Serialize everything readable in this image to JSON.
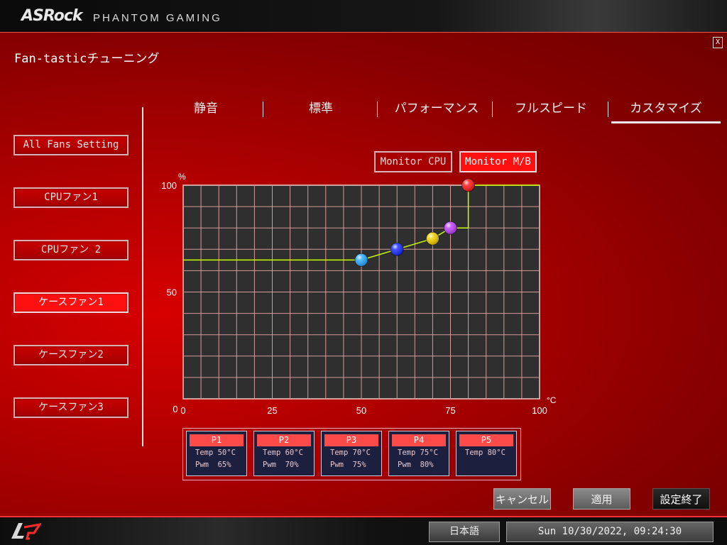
{
  "header": {
    "brand": "ASRock",
    "subtitle": "PHANTOM GAMING"
  },
  "window": {
    "title": "Fan-tasticチューニング",
    "close_label": "X"
  },
  "tabs": [
    {
      "label": "静音",
      "active": false
    },
    {
      "label": "標準",
      "active": false
    },
    {
      "label": "パフォーマンス",
      "active": false
    },
    {
      "label": "フルスピード",
      "active": false
    },
    {
      "label": "カスタマイズ",
      "active": true
    }
  ],
  "sidebar": {
    "items": [
      {
        "label": "All Fans Setting",
        "active": false
      },
      {
        "label": "CPUファン1",
        "active": false
      },
      {
        "label": "CPUファン 2",
        "active": false
      },
      {
        "label": "ケースファン1",
        "active": true
      },
      {
        "label": "ケースファン2",
        "active": false
      },
      {
        "label": "ケースファン3",
        "active": false
      }
    ]
  },
  "monitor": {
    "cpu_label": "Monitor CPU",
    "mb_label": "Monitor M/B",
    "selected": "Monitor M/B"
  },
  "chart_data": {
    "type": "line",
    "y_unit": "%",
    "x_unit": "°C",
    "xlim": [
      0,
      100
    ],
    "ylim": [
      0,
      100
    ],
    "x_ticks": [
      "0",
      "25",
      "50",
      "75",
      "100"
    ],
    "y_ticks": [
      "0",
      "50",
      "100"
    ],
    "grid": true,
    "curve": [
      [
        0,
        65
      ],
      [
        50,
        65
      ],
      [
        60,
        70
      ],
      [
        70,
        75
      ],
      [
        75,
        80
      ],
      [
        80,
        80
      ],
      [
        80,
        100
      ],
      [
        100,
        100
      ]
    ],
    "points": [
      {
        "name": "P1",
        "x": 50,
        "y": 65,
        "color": "#29a9ff"
      },
      {
        "name": "P2",
        "x": 60,
        "y": 70,
        "color": "#1a2bff"
      },
      {
        "name": "P3",
        "x": 70,
        "y": 75,
        "color": "#f0d000"
      },
      {
        "name": "P4",
        "x": 75,
        "y": 80,
        "color": "#c040ff"
      },
      {
        "name": "P5",
        "x": 80,
        "y": 100,
        "color": "#ff1a1a"
      }
    ],
    "line_color": "#c8ff00"
  },
  "point_info": [
    {
      "label": "P1",
      "temp": "Temp 50°C",
      "pwm": "Pwm  65%"
    },
    {
      "label": "P2",
      "temp": "Temp 60°C",
      "pwm": "Pwm  70%"
    },
    {
      "label": "P3",
      "temp": "Temp 70°C",
      "pwm": "Pwm  75%"
    },
    {
      "label": "P4",
      "temp": "Temp 75°C",
      "pwm": "Pwm  80%"
    },
    {
      "label": "P5",
      "temp": "Temp 80°C",
      "pwm": ""
    }
  ],
  "actions": {
    "cancel": "キャンセル",
    "apply": "適用",
    "finish": "設定終了"
  },
  "footer": {
    "language": "日本語",
    "datetime": "Sun 10/30/2022, 09:24:30"
  },
  "colors": {
    "accent": "#ff1a1a",
    "background": "#b00000",
    "panel": "#1d1f3e"
  }
}
